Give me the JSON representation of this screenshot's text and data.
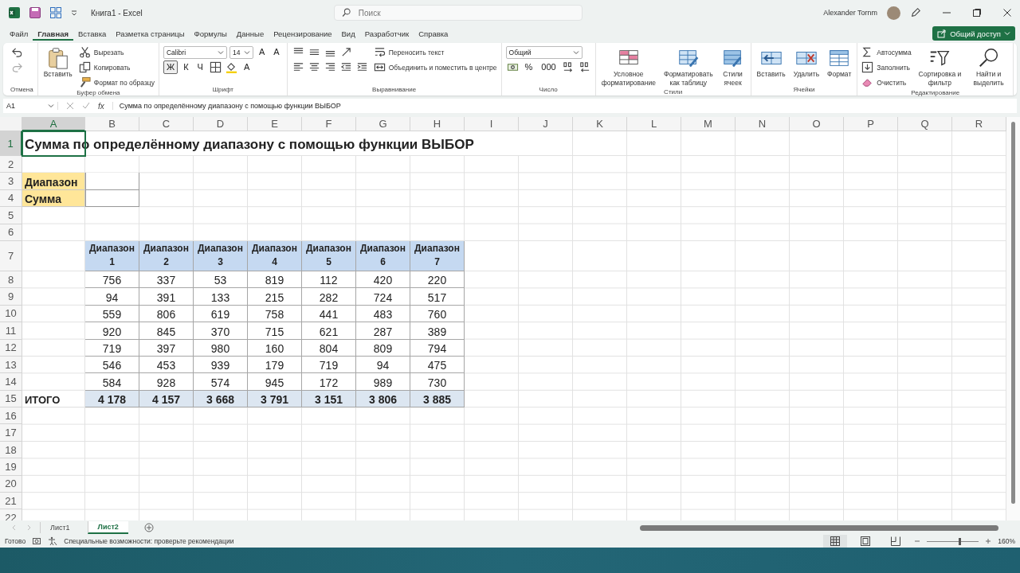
{
  "window": {
    "title": "Книга1  -  Excel",
    "search": {
      "placeholder": "Поиск"
    },
    "user": "Alexander Tornm",
    "share_button": "Общий доступ"
  },
  "menu_tabs": [
    {
      "label": "Файл",
      "selected": false
    },
    {
      "label": "Главная",
      "selected": true
    },
    {
      "label": "Вставка",
      "selected": false
    },
    {
      "label": "Разметка страницы",
      "selected": false
    },
    {
      "label": "Формулы",
      "selected": false
    },
    {
      "label": "Данные",
      "selected": false
    },
    {
      "label": "Рецензирование",
      "selected": false
    },
    {
      "label": "Вид",
      "selected": false
    },
    {
      "label": "Разработчик",
      "selected": false
    },
    {
      "label": "Справка",
      "selected": false
    }
  ],
  "ribbon": {
    "groups": [
      {
        "label": "Отмена",
        "columns": [
          {
            "kind": "stack",
            "rows": [
              [
                {
                  "kind": "icon"
                }
              ],
              [
                {
                  "kind": "icon"
                }
              ]
            ]
          }
        ]
      },
      {
        "label": "Буфер обмена",
        "columns": [
          {
            "kind": "large",
            "text": "Вставить"
          },
          {
            "kind": "stack",
            "rows": [
              [
                {
                  "kind": "button",
                  "text": "Вырезать"
                }
              ],
              [
                {
                  "kind": "button",
                  "text": "Копировать"
                }
              ],
              [
                {
                  "kind": "button",
                  "text": "Формат по образцу"
                }
              ]
            ]
          }
        ]
      },
      {
        "label": "Шрифт",
        "columns": [
          {
            "kind": "stack",
            "rows": [
              [
                {
                  "kind": "select",
                  "value": "Calibri"
                },
                {
                  "kind": "select",
                  "value": "14"
                },
                {
                  "kind": "glyph",
                  "text": "A",
                  "selected": false
                },
                {
                  "kind": "glyph",
                  "text": "A",
                  "selected": false
                }
              ],
              [
                {
                  "kind": "glyph",
                  "text": "Ж",
                  "selected": true
                },
                {
                  "kind": "glyph",
                  "text": "К",
                  "selected": false
                },
                {
                  "kind": "glyph",
                  "text": "Ч",
                  "selected": false
                },
                {
                  "kind": "icon"
                },
                {
                  "kind": "icon"
                },
                {
                  "kind": "glyph",
                  "text": "A",
                  "selected": false
                }
              ]
            ]
          }
        ]
      },
      {
        "label": "Выравнивание",
        "columns": [
          {
            "kind": "stack",
            "rows": [
              [
                {
                  "kind": "icon"
                },
                {
                  "kind": "icon"
                },
                {
                  "kind": "icon"
                },
                {
                  "kind": "icon"
                }
              ],
              [
                {
                  "kind": "icon"
                },
                {
                  "kind": "icon"
                },
                {
                  "kind": "icon"
                },
                {
                  "kind": "icon"
                },
                {
                  "kind": "icon"
                }
              ]
            ]
          },
          {
            "kind": "stack",
            "rows": [
              [
                {
                  "kind": "button",
                  "text": "Переносить текст"
                }
              ],
              [
                {
                  "kind": "button",
                  "text": "Объединить и поместить в центре"
                }
              ]
            ]
          }
        ]
      },
      {
        "label": "Число",
        "columns": [
          {
            "kind": "stack",
            "rows": [
              [
                {
                  "kind": "select",
                  "value": "Общий"
                }
              ],
              [
                {
                  "kind": "icon"
                },
                {
                  "kind": "glyph",
                  "text": "%",
                  "selected": false
                },
                {
                  "kind": "glyph",
                  "text": "000",
                  "selected": false
                },
                {
                  "kind": "icon"
                },
                {
                  "kind": "icon"
                }
              ]
            ]
          }
        ]
      },
      {
        "label": "Стили",
        "columns": [
          {
            "kind": "large",
            "text": "Условное форматирование"
          },
          {
            "kind": "large",
            "text": "Форматировать как таблицу"
          },
          {
            "kind": "large",
            "text": "Стили ячеек"
          }
        ]
      },
      {
        "label": "Ячейки",
        "columns": [
          {
            "kind": "large",
            "text": "Вставить"
          },
          {
            "kind": "large",
            "text": "Удалить"
          },
          {
            "kind": "large",
            "text": "Формат"
          }
        ]
      },
      {
        "label": "Редактирование",
        "columns": [
          {
            "kind": "stack",
            "rows": [
              [
                {
                  "kind": "button",
                  "text": "Автосумма"
                }
              ],
              [
                {
                  "kind": "button",
                  "text": "Заполнить"
                }
              ],
              [
                {
                  "kind": "button",
                  "text": "Очистить"
                }
              ]
            ]
          },
          {
            "kind": "large",
            "text": "Сортировка и фильтр"
          },
          {
            "kind": "large",
            "text": "Найти и выделить"
          }
        ]
      }
    ]
  },
  "formula_bar": {
    "name_box": "A1",
    "fx": "fx",
    "formula": "Сумма по определённому диапазону с помощью функции ВЫБОР"
  },
  "sheet": {
    "columns": [
      {
        "label": "A",
        "selected": true
      },
      {
        "label": "B",
        "selected": false
      },
      {
        "label": "C",
        "selected": false
      },
      {
        "label": "D",
        "selected": false
      },
      {
        "label": "E",
        "selected": false
      },
      {
        "label": "F",
        "selected": false
      },
      {
        "label": "G",
        "selected": false
      },
      {
        "label": "H",
        "selected": false
      },
      {
        "label": "I",
        "selected": false
      },
      {
        "label": "J",
        "selected": false
      },
      {
        "label": "K",
        "selected": false
      },
      {
        "label": "L",
        "selected": false
      },
      {
        "label": "M",
        "selected": false
      },
      {
        "label": "N",
        "selected": false
      },
      {
        "label": "O",
        "selected": false
      },
      {
        "label": "P",
        "selected": false
      },
      {
        "label": "Q",
        "selected": false
      },
      {
        "label": "R",
        "selected": false
      }
    ],
    "rows": [
      {
        "number": "1",
        "selected": true,
        "kind": "title",
        "text": "Сумма по определённому диапазону с помощью функции ВЫБОР"
      },
      {
        "number": "2",
        "selected": false,
        "kind": "blank"
      },
      {
        "number": "3",
        "selected": false,
        "kind": "label",
        "text": "Диапазон"
      },
      {
        "number": "4",
        "selected": false,
        "kind": "label",
        "text": "Сумма"
      },
      {
        "number": "5",
        "selected": false,
        "kind": "blank"
      },
      {
        "number": "6",
        "selected": false,
        "kind": "blank"
      },
      {
        "number": "7",
        "selected": false,
        "kind": "header",
        "values": [
          "Диапазон 1",
          "Диапазон 2",
          "Диапазон 3",
          "Диапазон 4",
          "Диапазон 5",
          "Диапазон 6",
          "Диапазон 7"
        ]
      },
      {
        "number": "8",
        "selected": false,
        "kind": "data",
        "values": [
          "756",
          "337",
          "53",
          "819",
          "112",
          "420",
          "220"
        ]
      },
      {
        "number": "9",
        "selected": false,
        "kind": "data",
        "values": [
          "94",
          "391",
          "133",
          "215",
          "282",
          "724",
          "517"
        ]
      },
      {
        "number": "10",
        "selected": false,
        "kind": "data",
        "values": [
          "559",
          "806",
          "619",
          "758",
          "441",
          "483",
          "760"
        ]
      },
      {
        "number": "11",
        "selected": false,
        "kind": "data",
        "values": [
          "920",
          "845",
          "370",
          "715",
          "621",
          "287",
          "389"
        ]
      },
      {
        "number": "12",
        "selected": false,
        "kind": "data",
        "values": [
          "719",
          "397",
          "980",
          "160",
          "804",
          "809",
          "794"
        ]
      },
      {
        "number": "13",
        "selected": false,
        "kind": "data",
        "values": [
          "546",
          "453",
          "939",
          "179",
          "719",
          "94",
          "475"
        ]
      },
      {
        "number": "14",
        "selected": false,
        "kind": "data",
        "values": [
          "584",
          "928",
          "574",
          "945",
          "172",
          "989",
          "730"
        ]
      },
      {
        "number": "15",
        "selected": false,
        "kind": "total",
        "text": "ИТОГО",
        "values": [
          "4 178",
          "4 157",
          "3 668",
          "3 791",
          "3 151",
          "3 806",
          "3 885"
        ]
      },
      {
        "number": "16",
        "selected": false,
        "kind": "blank"
      },
      {
        "number": "17",
        "selected": false,
        "kind": "blank"
      },
      {
        "number": "18",
        "selected": false,
        "kind": "blank"
      },
      {
        "number": "19",
        "selected": false,
        "kind": "blank"
      },
      {
        "number": "20",
        "selected": false,
        "kind": "blank"
      },
      {
        "number": "21",
        "selected": false,
        "kind": "blank"
      },
      {
        "number": "22",
        "selected": false,
        "kind": "blank"
      }
    ]
  },
  "sheet_tabs": [
    {
      "label": "Лист1",
      "selected": false
    },
    {
      "label": "Лист2",
      "selected": true
    }
  ],
  "status_bar": {
    "mode": "Готово",
    "accessibility": "Специальные возможности: проверьте рекомендации",
    "views": [
      {
        "selected": true
      },
      {
        "selected": false
      },
      {
        "selected": false
      }
    ],
    "zoom": {
      "level": 0.62,
      "reading": "160%"
    }
  }
}
